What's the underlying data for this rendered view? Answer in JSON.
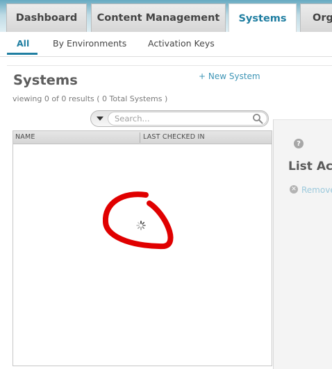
{
  "top_tabs": {
    "dashboard": "Dashboard",
    "content_management": "Content Management",
    "systems": "Systems",
    "org": "Org"
  },
  "sub_nav": {
    "all": "All",
    "by_environments": "By Environments",
    "activation_keys": "Activation Keys"
  },
  "page": {
    "title": "Systems",
    "new_system_link": "+ New System",
    "result_count": "viewing 0 of 0 results ( 0 Total Systems )"
  },
  "search": {
    "placeholder": "Search...",
    "value": ""
  },
  "list": {
    "columns": [
      "NAME",
      "LAST CHECKED IN"
    ],
    "loading": true
  },
  "side_panel": {
    "title": "List Act",
    "remove_label": "Remove"
  },
  "icons": {
    "filter": "dropdown-arrow-icon",
    "search": "magnifier-icon",
    "help": "question-mark-icon",
    "remove": "remove-x-icon",
    "loading": "spinner-icon"
  },
  "colors": {
    "accent": "#1f7ea1",
    "link": "#3e95b6",
    "annotation": "#e00000"
  }
}
